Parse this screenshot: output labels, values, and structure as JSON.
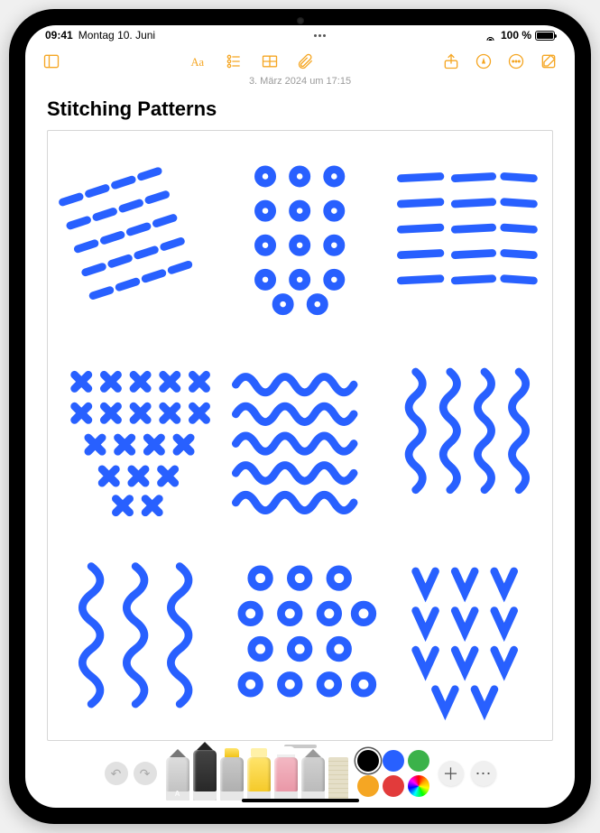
{
  "status": {
    "time": "09:41",
    "date": "Montag 10. Juni",
    "battery": "100 %"
  },
  "timestamp": "3. März 2024 um 17:15",
  "note": {
    "title": "Stitching Patterns"
  },
  "markup": {
    "tools": [
      {
        "name": "scribble",
        "label": "A"
      },
      {
        "name": "pen"
      },
      {
        "name": "marker"
      },
      {
        "name": "highlighter"
      },
      {
        "name": "eraser"
      },
      {
        "name": "lasso"
      },
      {
        "name": "ruler"
      }
    ],
    "colors": [
      "#000000",
      "#2860ff",
      "#3bb24a",
      "#f5a623",
      "#e23b3b",
      "rainbow"
    ],
    "selected_color": "#000000",
    "selected_tool": "pen"
  },
  "drawing": {
    "stroke_color": "#2860ff",
    "patterns": [
      "diagonal-dashes",
      "dot-grid",
      "horizontal-dashes",
      "x-grid",
      "zigzag-rows",
      "vertical-squiggles",
      "vertical-squiggle-cols",
      "circle-grid",
      "v-marks"
    ]
  }
}
